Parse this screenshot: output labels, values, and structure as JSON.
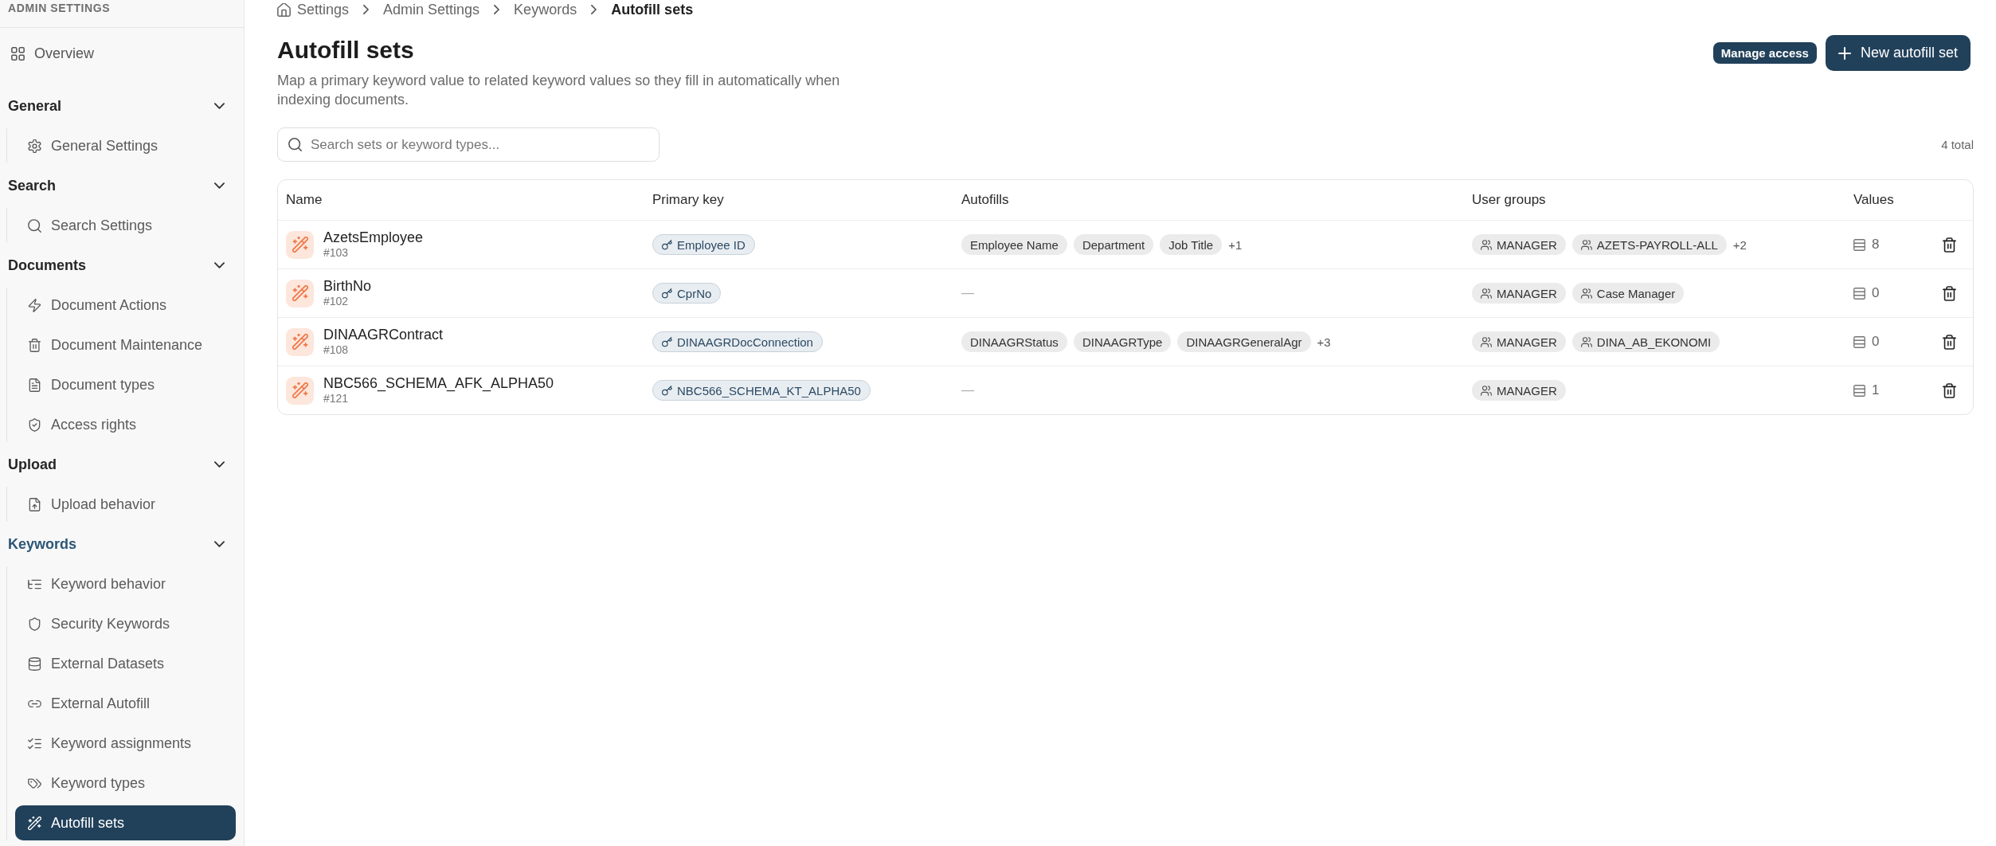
{
  "sidebar": {
    "title": "ADMIN SETTINGS",
    "overview": {
      "label": "Overview",
      "selected": false
    },
    "groups": [
      {
        "label": "General",
        "expanded": true,
        "items": [
          {
            "label": "General Settings",
            "selected": false
          }
        ]
      },
      {
        "label": "Search",
        "expanded": true,
        "items": [
          {
            "label": "Search Settings",
            "selected": false
          }
        ]
      },
      {
        "label": "Documents",
        "expanded": true,
        "items": [
          {
            "label": "Document Actions",
            "selected": false
          },
          {
            "label": "Document Maintenance",
            "selected": false
          },
          {
            "label": "Document types",
            "selected": false
          },
          {
            "label": "Access rights",
            "selected": false
          }
        ]
      },
      {
        "label": "Upload",
        "expanded": true,
        "items": [
          {
            "label": "Upload behavior",
            "selected": false
          }
        ]
      },
      {
        "label": "Keywords",
        "expanded": true,
        "items": [
          {
            "label": "Keyword behavior",
            "selected": false
          },
          {
            "label": "Security Keywords",
            "selected": false
          },
          {
            "label": "External Datasets",
            "selected": false
          },
          {
            "label": "External Autofill",
            "selected": false
          },
          {
            "label": "Keyword assignments",
            "selected": false
          },
          {
            "label": "Keyword types",
            "selected": false
          },
          {
            "label": "Autofill sets",
            "selected": true
          }
        ]
      }
    ]
  },
  "breadcrumb": [
    {
      "label": "Settings",
      "current": false
    },
    {
      "label": "Admin Settings",
      "current": false
    },
    {
      "label": "Keywords",
      "current": false
    },
    {
      "label": "Autofill sets",
      "current": true
    }
  ],
  "header": {
    "title": "Autofill sets",
    "description": "Map a primary keyword value to related keyword values so they fill in automatically when indexing documents.",
    "actions": [
      {
        "label": "Manage access",
        "kind": "secondary"
      },
      {
        "label": "New autofill set",
        "kind": "primary"
      }
    ]
  },
  "toolbar": {
    "search": {
      "placeholder": "Search sets or keyword types..."
    },
    "total": "4 total"
  },
  "table": {
    "columns": [
      "Name",
      "Primary key",
      "Autofills",
      "User groups",
      "Values"
    ],
    "rows": [
      {
        "name": "AzetsEmployee",
        "id": "#103",
        "primary_key": "Employee ID",
        "autofills": [
          "Employee Name",
          "Department",
          "Job Title"
        ],
        "autofills_more": "+1",
        "user_groups": [
          "MANAGER",
          "AZETS-PAYROLL-ALL"
        ],
        "user_groups_more": "+2",
        "values": "8"
      },
      {
        "name": "BirthNo",
        "id": "#102",
        "primary_key": "CprNo",
        "autofills_empty": "—",
        "user_groups": [
          "MANAGER",
          "Case Manager"
        ],
        "values": "0"
      },
      {
        "name": "DINAAGRContract",
        "id": "#108",
        "primary_key": "DINAAGRDocConnection",
        "autofills": [
          "DINAAGRStatus",
          "DINAAGRType",
          "DINAAGRGeneralAgr"
        ],
        "autofills_more": "+3",
        "user_groups": [
          "MANAGER",
          "DINA_AB_EKONOMI"
        ],
        "values": "0"
      },
      {
        "name": "NBC566_SCHEMA_AFK_ALPHA50",
        "id": "#121",
        "primary_key": "NBC566_SCHEMA_KT_ALPHA50",
        "autofills_empty": "—",
        "user_groups": [
          "MANAGER"
        ],
        "values": "1"
      }
    ]
  }
}
